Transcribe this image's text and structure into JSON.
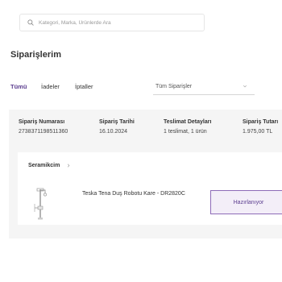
{
  "search": {
    "placeholder": "Kategori, Marka, Ürünlerde Ara",
    "icon": "search-icon"
  },
  "page": {
    "title": "Siparişlerim"
  },
  "tabs": [
    {
      "label": "Tümü",
      "active": true
    },
    {
      "label": "İadeler",
      "active": false
    },
    {
      "label": "İptaller",
      "active": false
    }
  ],
  "filter": {
    "selected": "Tüm Siparişler",
    "icon": "chevron-down-icon"
  },
  "order": {
    "number_label": "Sipariş Numarası",
    "number": "2738371198511360",
    "date_label": "Sipariş Tarihi",
    "date": "16.10.2024",
    "delivery_label": "Teslimat Detayları",
    "delivery": "1 teslimat, 1 ürün",
    "total_label": "Sipariş Tutarı",
    "total": "1.975,00 TL"
  },
  "shipment": {
    "store": "Seramikcim",
    "store_icon": "chevron-right-icon",
    "product_name": "Teska Tena Duş Robotu Kare - DR2820C",
    "product_icon": "shower-robot-image",
    "status": "Hazırlanıyor"
  },
  "colors": {
    "accent": "#5b3d8f",
    "status_border": "#8e6cb8",
    "status_bg": "#f3eef8",
    "panel_bg": "#f5f5f5"
  }
}
